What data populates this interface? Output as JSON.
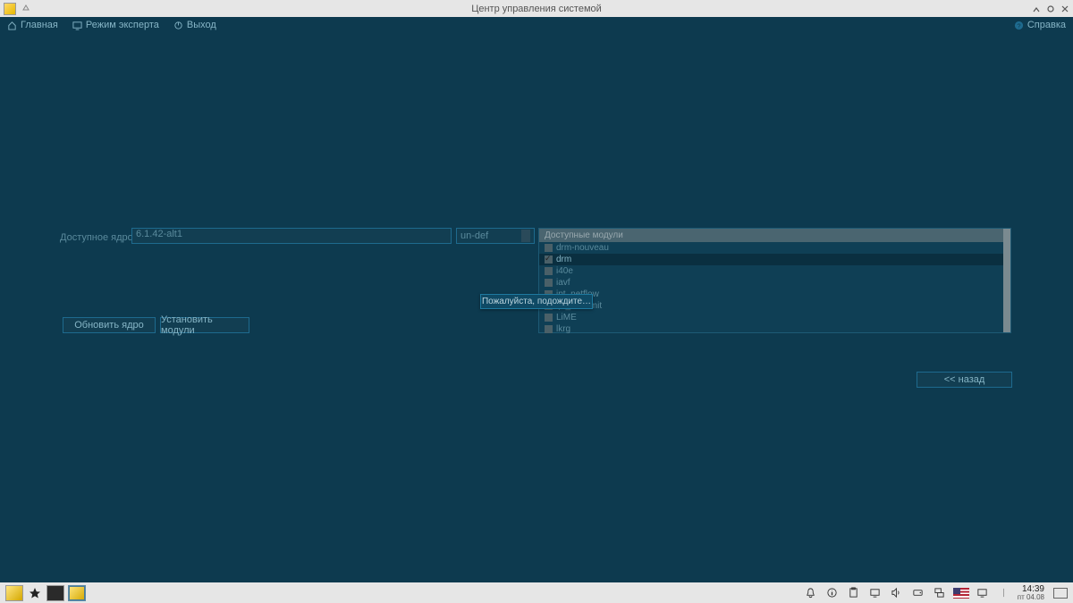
{
  "titlebar": {
    "title": "Центр управления системой"
  },
  "menubar": {
    "home": "Главная",
    "expert": "Режим эксперта",
    "exit": "Выход",
    "help": "Справка"
  },
  "form": {
    "kernel_label": "Доступное ядро:",
    "kernel_value": "6.1.42-alt1",
    "type_value": "un-def"
  },
  "buttons": {
    "update": "Обновить ядро",
    "install": "Установить модули",
    "back": "<<    назад"
  },
  "modules": {
    "header": "Доступные модули",
    "items": [
      {
        "label": "drm-nouveau",
        "checked": false,
        "selected": false
      },
      {
        "label": "drm",
        "checked": true,
        "selected": true
      },
      {
        "label": "i40e",
        "checked": false,
        "selected": false
      },
      {
        "label": "iavf",
        "checked": false,
        "selected": false
      },
      {
        "label": "ipt_netflow",
        "checked": false,
        "selected": false
      },
      {
        "label": "ipt_ratelimit",
        "checked": false,
        "selected": false
      },
      {
        "label": "LiME",
        "checked": false,
        "selected": false
      },
      {
        "label": "lkrg",
        "checked": false,
        "selected": false
      }
    ]
  },
  "popup": {
    "text": "Пожалуйста, подождите…"
  },
  "taskbar": {
    "time": "14:39",
    "date": "пт 04.08"
  }
}
